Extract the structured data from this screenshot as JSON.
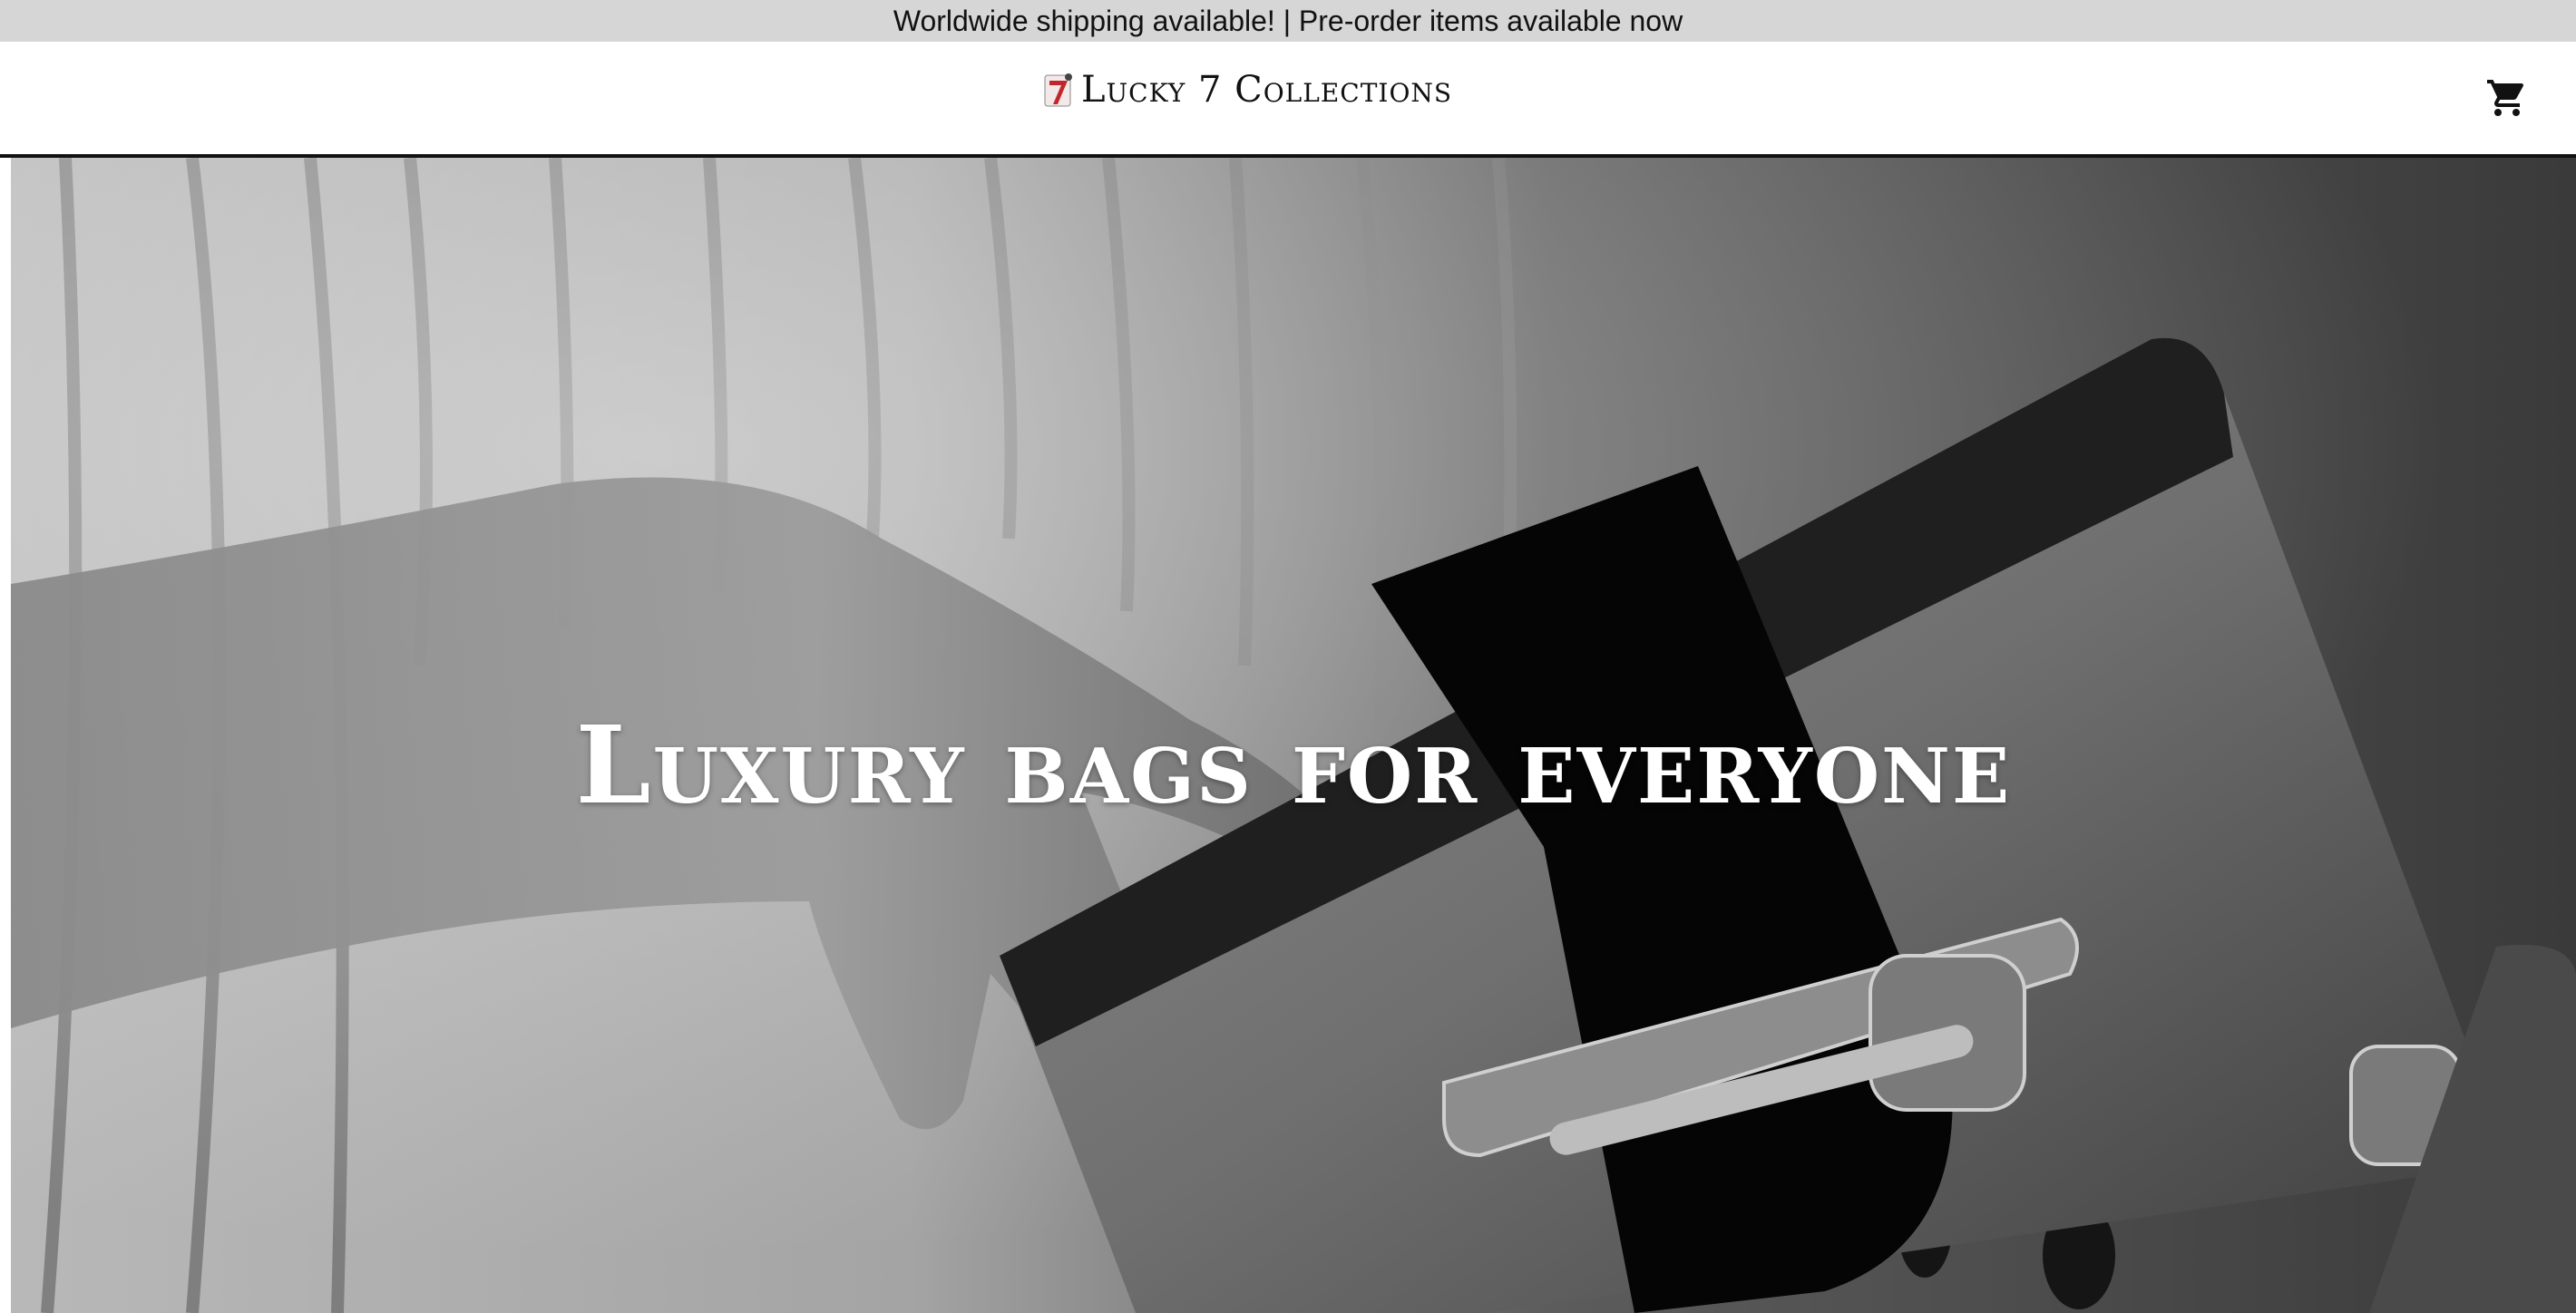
{
  "announcement": {
    "text": "Worldwide shipping available! | Pre-order items available now"
  },
  "header": {
    "brand_name": "Lucky 7 Collections",
    "logo_icon": "lucky-7-logo-icon",
    "cart_icon": "shopping-cart-icon"
  },
  "hero": {
    "title": "Luxury bags for everyone",
    "image_description_icon": "hero-handbag-photo"
  },
  "colors": {
    "announcement_bg": "#d6d6d6",
    "header_border": "#111111",
    "logo_accent": "#c0282d"
  }
}
